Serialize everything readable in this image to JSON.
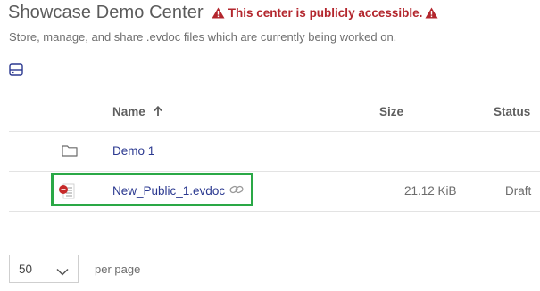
{
  "page": {
    "title": "Showcase Demo Center",
    "warning": "This center is publicly accessible.",
    "subtitle": "Store, manage, and share .evdoc files which are currently being worked on."
  },
  "toolbar": {
    "view_toggle_icon": "list-view-icon"
  },
  "table": {
    "columns": {
      "name": "Name",
      "size": "Size",
      "status": "Status"
    },
    "sort_icon": "arrow-up-icon",
    "rows": [
      {
        "icon": "folder-icon",
        "name": "Demo 1",
        "size": "",
        "status": ""
      },
      {
        "icon": "evdoc-file-icon",
        "name": "New_Public_1.evdoc",
        "link_icon": "link-icon",
        "size": "21.12 KiB",
        "status": "Draft"
      }
    ]
  },
  "pagination": {
    "page_size": "50",
    "per_page_label": "per page"
  },
  "colors": {
    "title": "#5b5b5b",
    "warning": "#b3262d",
    "link": "#2b3990",
    "highlight": "#2aa846",
    "divider": "#e3e3e3"
  }
}
